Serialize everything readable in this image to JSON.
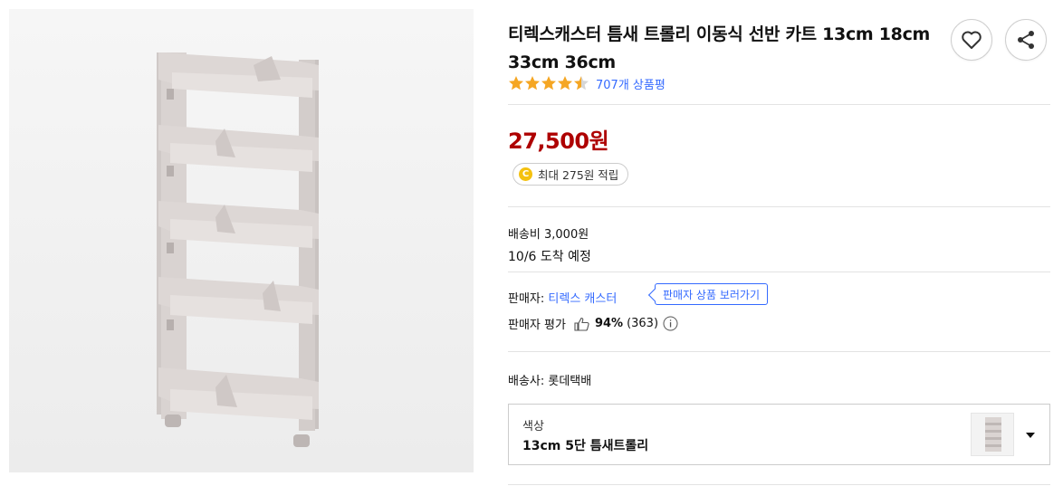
{
  "product": {
    "title": "티렉스캐스터 틈새 트롤리 이동식 선반 카트 13cm 18cm 33cm 36cm",
    "rating_stars": 4.5,
    "review_count": "707개 상품평",
    "price": "27,500원",
    "cash_reward": "최대 275원 적립",
    "cash_icon_letter": "C"
  },
  "shipping": {
    "fee": "배송비 3,000원",
    "arrival": "10/6 도착 예정"
  },
  "seller": {
    "label": "판매자: ",
    "name": "티렉스 캐스터",
    "tooltip": "판매자 상품 보러가기",
    "rating_label": "판매자 평가",
    "rating_percent": "94%",
    "rating_count": "(363)"
  },
  "delivery": {
    "carrier": "배송사: 롯데택배"
  },
  "option": {
    "label": "색상",
    "value": "13cm 5단 틈새트롤리"
  },
  "colors": {
    "price": "#ae0000",
    "link": "#346aff",
    "star": "#f5a623"
  },
  "icons": {
    "wishlist": "heart-icon",
    "share": "share-icon",
    "thumbs": "thumbs-up-icon",
    "info": "info-icon",
    "dropdown": "chevron-down-icon"
  }
}
